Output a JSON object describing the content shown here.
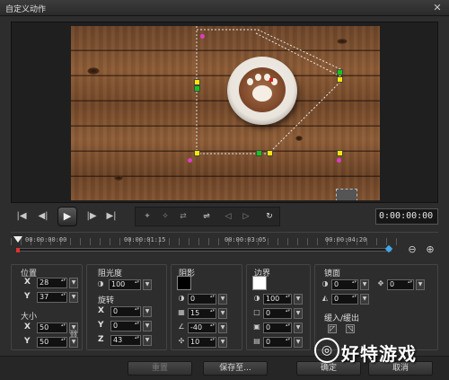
{
  "window": {
    "title": "自定义动作",
    "close_glyph": "✕"
  },
  "transport": {
    "icons": [
      "go-to-start-icon",
      "previous-frame-icon",
      "play-icon",
      "next-frame-icon",
      "go-to-end-icon"
    ],
    "timecode": "0:00:00:00"
  },
  "ruler": {
    "labels": [
      "00:00:00:00",
      "00:00:01:15",
      "00:00:03:05",
      "00:00:04:20"
    ],
    "zoom_out": "⊖",
    "zoom_in": "⊕"
  },
  "position": {
    "title": "位置",
    "x_label": "X",
    "x_value": "28",
    "y_label": "Y",
    "y_value": "37"
  },
  "size": {
    "title": "大小",
    "x_label": "X",
    "x_value": "50",
    "y_label": "Y",
    "y_value": "50"
  },
  "opacity": {
    "title": "阻光度",
    "value": "100"
  },
  "rotation": {
    "title": "旋转",
    "x_label": "X",
    "x_value": "0",
    "y_label": "Y",
    "y_value": "0",
    "z_label": "Z",
    "z_value": "43"
  },
  "shadow": {
    "title": "阴影",
    "color": "#000000",
    "opacity": "0",
    "blur": "15",
    "angle": "-40",
    "distance": "10"
  },
  "border": {
    "title": "边界",
    "color": "#ffffff",
    "opacity": "100",
    "v1": "0",
    "v2": "0",
    "v3": "0"
  },
  "mirror": {
    "title": "镜面",
    "v1": "0",
    "v2": "0",
    "v3": "0"
  },
  "fade": {
    "title": "缓入/缓出"
  },
  "footer": {
    "reset": "重置",
    "save_as": "保存至...",
    "ok": "确定",
    "cancel": "取消"
  },
  "watermark": {
    "logo": "◎",
    "text": "好特游戏"
  }
}
